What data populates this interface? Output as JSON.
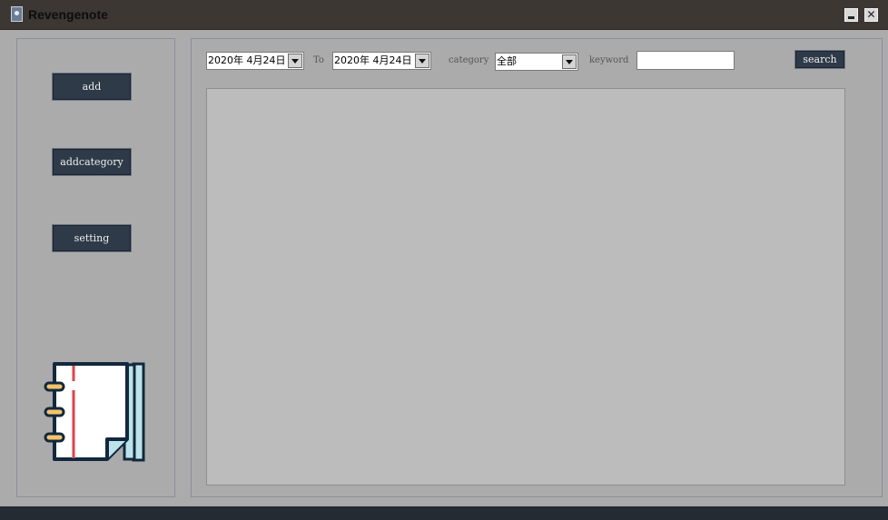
{
  "window": {
    "title": "Revengenote"
  },
  "sidebar": {
    "add_label": "add",
    "addcategory_label": "addcategory",
    "setting_label": "setting"
  },
  "filter": {
    "date_from": "2020年  4月24日",
    "to_label": "To",
    "date_to": "2020年  4月24日",
    "category_label": "category",
    "category_value": "全部",
    "keyword_label": "keyword",
    "keyword_value": "",
    "search_label": "search"
  },
  "icons": {
    "app": "notebook-icon",
    "notebook": "notebook-illustration-icon",
    "minimize": "minimize-icon",
    "close": "close-icon",
    "dropdown": "chevron-down-icon"
  },
  "colors": {
    "titlebar": "#3d3734",
    "window_bg": "#ababab",
    "button_bg": "#2e3a48",
    "list_bg": "#bcbcbc"
  }
}
